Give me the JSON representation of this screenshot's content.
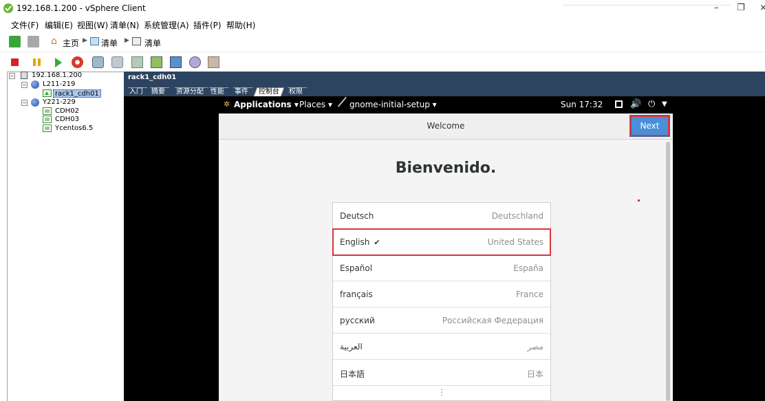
{
  "window": {
    "title": "192.168.1.200 - vSphere Client",
    "minimize": "–",
    "restore": "❐",
    "close": "×"
  },
  "menu": [
    "文件(F)",
    "编辑(E)",
    "视图(W)",
    "清单(N)",
    "系统管理(A)",
    "插件(P)",
    "帮助(H)"
  ],
  "nav": {
    "home": "主页",
    "inventory1": "清单",
    "inventory2": "清单"
  },
  "tree": {
    "host": "192.168.1.200",
    "pool1": "L211-219",
    "vm_selected": "rack1_cdh01",
    "pool2": "Y221-229",
    "vm2": "CDH02",
    "vm3": "CDH03",
    "vm4": "Ycentos6.5"
  },
  "console": {
    "vm_name": "rack1_cdh01",
    "tabs": [
      "入门",
      "摘要",
      "资源分配",
      "性能",
      "事件",
      "控制台",
      "权限"
    ],
    "active_tab": "控制台"
  },
  "gnome": {
    "applications": "Applications ▾",
    "places": "Places ▾",
    "app_name": "gnome-initial-setup ▾",
    "clock": "Sun 17:32"
  },
  "setup": {
    "header_title": "Welcome",
    "next_label": "Next",
    "heading": "Bienvenido.",
    "languages": [
      {
        "name": "Deutsch",
        "region": "Deutschland",
        "selected": false
      },
      {
        "name": "English",
        "region": "United States",
        "selected": true
      },
      {
        "name": "Español",
        "region": "España",
        "selected": false
      },
      {
        "name": "français",
        "region": "France",
        "selected": false
      },
      {
        "name": "русский",
        "region": "Российская Федерация",
        "selected": false
      },
      {
        "name": "العربية",
        "region": "مصر",
        "selected": false
      },
      {
        "name": "日本語",
        "region": "日本",
        "selected": false
      }
    ],
    "check_mark": "✔",
    "more": "⋮"
  }
}
